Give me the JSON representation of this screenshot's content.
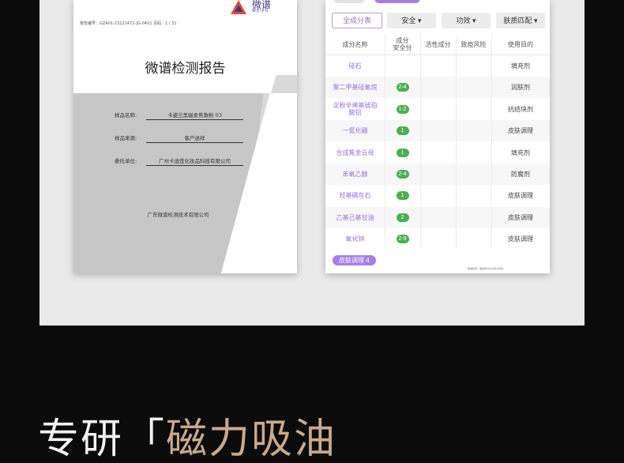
{
  "report": {
    "number_line": "报告编号：GZA01-23121472-JG-04V1    页码：1 / 31",
    "logo_cn": "微谱",
    "logo_en": "WEIPU",
    "title": "微谱检测报告",
    "fields": [
      {
        "label": "样品名称:",
        "value": "卡姿兰黑磁柔焦散粉 03"
      },
      {
        "label": "样品来源:",
        "value": "客户送样"
      },
      {
        "label": "委托单位:",
        "value": "广州卡迪莲化妆品科技有限公司"
      }
    ],
    "company": "广东微谱检测技术有限公司"
  },
  "ingredient_table": {
    "filters": [
      "全成分表",
      "安全 ▾",
      "功效 ▾",
      "肤质匹配 ▾"
    ],
    "active_filter": 0,
    "headers": [
      "成分名称",
      "成分\n安全分",
      "活性成分",
      "致痘风险",
      "使用目的"
    ],
    "rows": [
      {
        "name": "硅石",
        "score": "",
        "purpose": "填充剂"
      },
      {
        "name": "聚二甲基硅氧烷",
        "score": "2-4",
        "purpose": "润肤剂"
      },
      {
        "name": "淀粉辛烯基琥珀酸铝",
        "score": "1-2",
        "purpose": "抗结块剂"
      },
      {
        "name": "一氮化硼",
        "score": "1",
        "purpose": "皮肤调理"
      },
      {
        "name": "合成氟金云母",
        "score": "1",
        "purpose": "填充剂"
      },
      {
        "name": "苯氧乙醇",
        "score": "2-4",
        "purpose": "防腐剂"
      },
      {
        "name": "羟基磷灰石",
        "score": "1",
        "purpose": "皮肤调理"
      },
      {
        "name": "乙基己基甘油",
        "score": "2",
        "purpose": "皮肤调理"
      },
      {
        "name": "氧化锌",
        "score": "2-9",
        "purpose": "皮肤调理"
      }
    ],
    "tag": "皮肤调理 4",
    "footnote": "数据来源：美丽修行APP成分查询",
    "colors": {
      "accent": "#9a6fe0",
      "badge": "#4caf50",
      "tag": "#a57fe8"
    }
  },
  "slogan": {
    "white": "专研「",
    "gold": "磁力吸油"
  }
}
